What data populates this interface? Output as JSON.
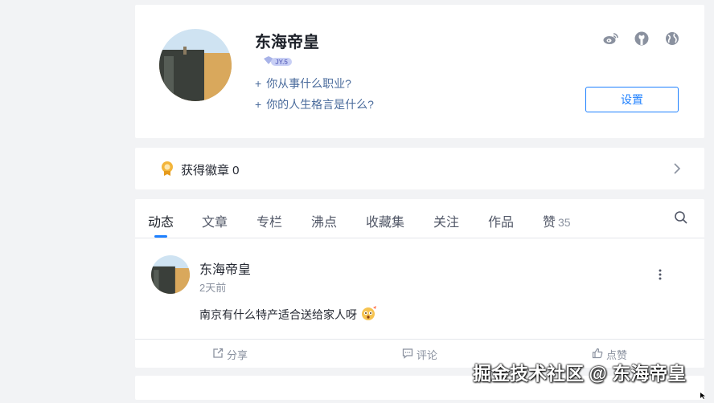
{
  "profile": {
    "username": "东海帝皇",
    "level_badge": "JY.5",
    "prompt_job": "你从事什么职业?",
    "prompt_motto": "你的人生格言是什么?",
    "prompt_plus": "+",
    "settings_label": "设置",
    "social_icons": [
      "weibo-icon",
      "github-icon",
      "globe-icon"
    ]
  },
  "badges": {
    "label": "获得徽章 0"
  },
  "tabs": [
    {
      "label": "动态",
      "active": true
    },
    {
      "label": "文章"
    },
    {
      "label": "专栏"
    },
    {
      "label": "沸点"
    },
    {
      "label": "收藏集"
    },
    {
      "label": "关注"
    },
    {
      "label": "作品"
    },
    {
      "label": "赞",
      "count": "35"
    }
  ],
  "post": {
    "author": "东海帝皇",
    "time": "2天前",
    "content": "南京有什么特产适合送给家人呀",
    "actions": [
      {
        "label": "分享",
        "icon": "share-icon"
      },
      {
        "label": "评论",
        "icon": "comment-icon"
      },
      {
        "label": "点赞",
        "icon": "thumbs-up-icon"
      }
    ]
  },
  "watermark": "掘金技术社区 @ 东海帝皇",
  "colors": {
    "accent": "#1e80ff",
    "background": "#f2f3f5",
    "prompt": "#4a6b9c",
    "muted": "#8a919f"
  }
}
